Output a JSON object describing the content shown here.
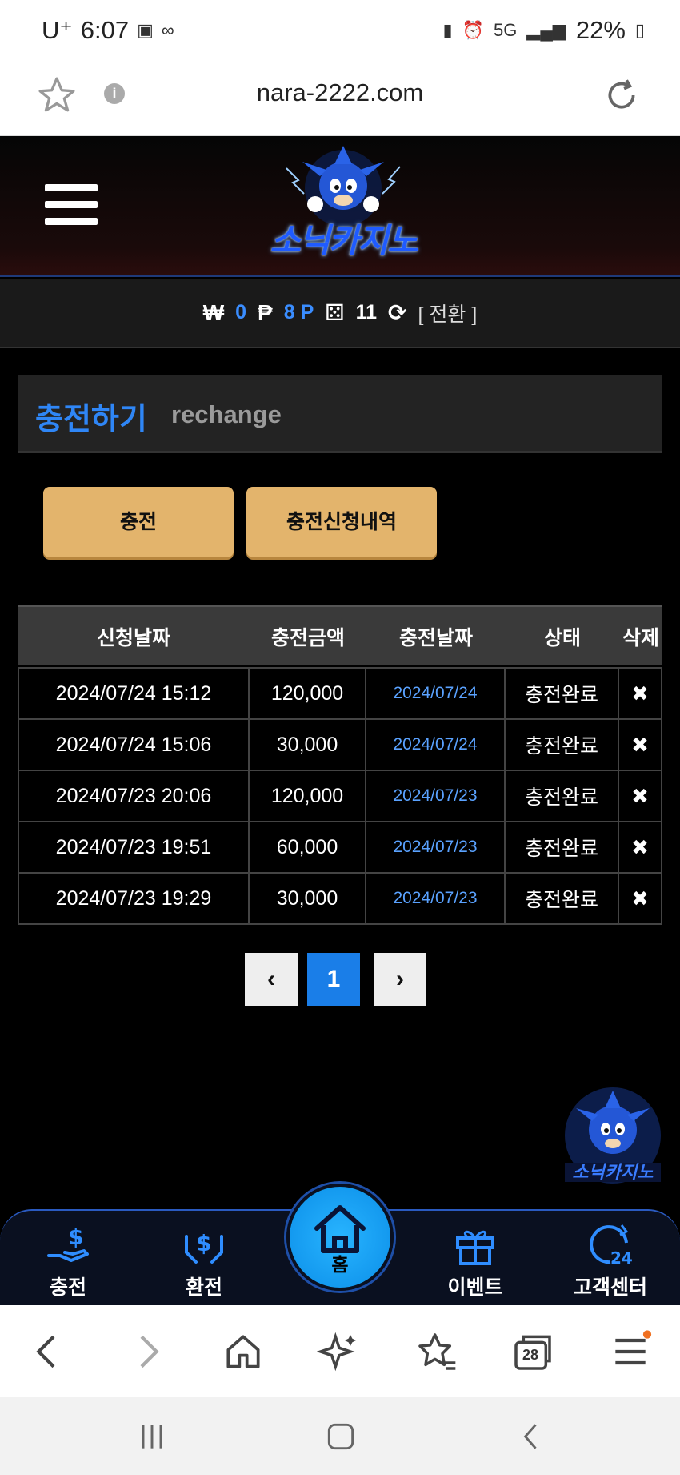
{
  "status_bar": {
    "carrier": "U⁺",
    "time": "6:07",
    "network": "5G",
    "battery": "22%"
  },
  "browser": {
    "url": "nara-2222.com"
  },
  "site": {
    "logo_text": "소닉카지노"
  },
  "balance": {
    "won_symbol": "₩",
    "won_value": "0",
    "point_symbol": "₱",
    "point_value": "8 P",
    "coupon_value": "11",
    "switch_label": "[ 전환 ]"
  },
  "section": {
    "title_ko": "충전하기",
    "title_en": "rechange"
  },
  "buttons": {
    "charge": "충전",
    "history": "충전신청내역"
  },
  "table": {
    "headers": [
      "신청날짜",
      "충전금액",
      "충전날짜",
      "상태",
      "삭제"
    ],
    "rows": [
      {
        "request_date": "2024/07/24 15:12",
        "amount": "120,000",
        "charge_date": "2024/07/24",
        "status": "충전완료",
        "delete": "✖"
      },
      {
        "request_date": "2024/07/24 15:06",
        "amount": "30,000",
        "charge_date": "2024/07/24",
        "status": "충전완료",
        "delete": "✖"
      },
      {
        "request_date": "2024/07/23 20:06",
        "amount": "120,000",
        "charge_date": "2024/07/23",
        "status": "충전완료",
        "delete": "✖"
      },
      {
        "request_date": "2024/07/23 19:51",
        "amount": "60,000",
        "charge_date": "2024/07/23",
        "status": "충전완료",
        "delete": "✖"
      },
      {
        "request_date": "2024/07/23 19:29",
        "amount": "30,000",
        "charge_date": "2024/07/23",
        "status": "충전완료",
        "delete": "✖"
      }
    ]
  },
  "pagination": {
    "prev": "‹",
    "current": "1",
    "next": "›"
  },
  "bottom_nav": {
    "charge": "충전",
    "exchange": "환전",
    "home": "홈",
    "event": "이벤트",
    "support": "고객센터"
  },
  "browser_toolbar": {
    "tabs_count": "28"
  },
  "colors": {
    "accent_blue": "#2f86f6",
    "button_gold": "#e3b46c",
    "page_bg": "#000000"
  }
}
